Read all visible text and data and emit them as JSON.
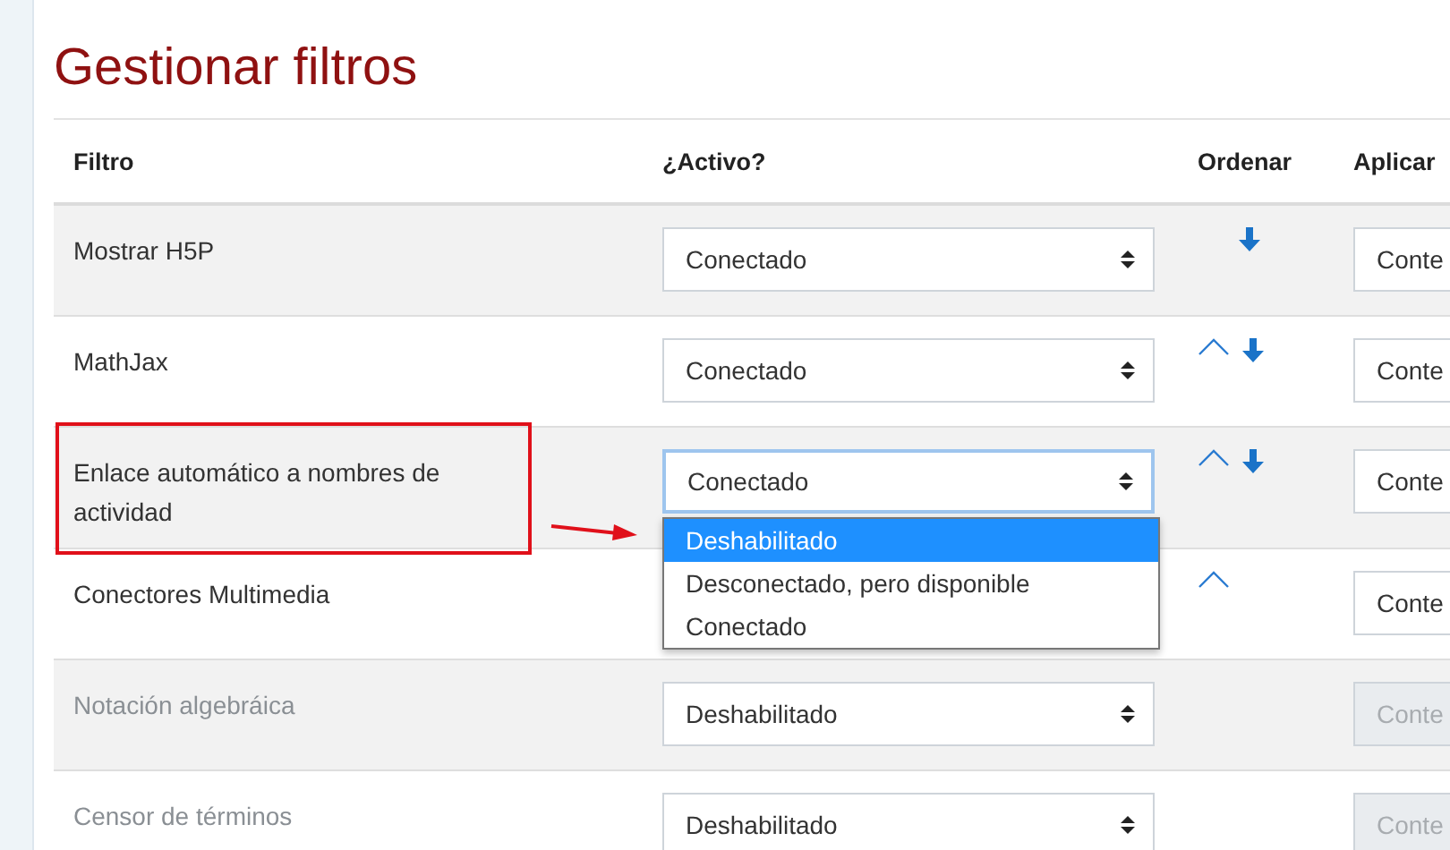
{
  "title": "Gestionar filtros",
  "columns": [
    "Filtro",
    "¿Activo?",
    "Ordenar",
    "Aplicar"
  ],
  "rows": [
    {
      "name": "Mostrar H5P",
      "disabled": false,
      "active": "Conectado",
      "move_up": false,
      "move_down": true,
      "apply": "Conte",
      "highlighted": false
    },
    {
      "name": "MathJax",
      "disabled": false,
      "active": "Conectado",
      "move_up": true,
      "move_down": true,
      "apply": "Conte",
      "highlighted": false
    },
    {
      "name": "Enlace automático a nombres de actividad",
      "disabled": false,
      "active": "Conectado",
      "move_up": true,
      "move_down": true,
      "apply": "Conte",
      "highlighted": true,
      "dropdown": [
        {
          "label": "Deshabilitado",
          "selected": true
        },
        {
          "label": "Desconectado, pero disponible",
          "selected": false
        },
        {
          "label": "Conectado",
          "selected": false
        }
      ]
    },
    {
      "name": "Conectores Multimedia",
      "disabled": false,
      "move_up": true,
      "move_down": false,
      "apply": "Conte",
      "highlighted": false
    },
    {
      "name": "Notación algebráica",
      "disabled": true,
      "active": "Deshabilitado",
      "move_up": false,
      "move_down": false,
      "apply": "Conte",
      "highlighted": false
    },
    {
      "name": "Censor de términos",
      "disabled": true,
      "active": "Deshabilitado",
      "move_up": false,
      "move_down": false,
      "apply": "Conte",
      "highlighted": false
    }
  ]
}
